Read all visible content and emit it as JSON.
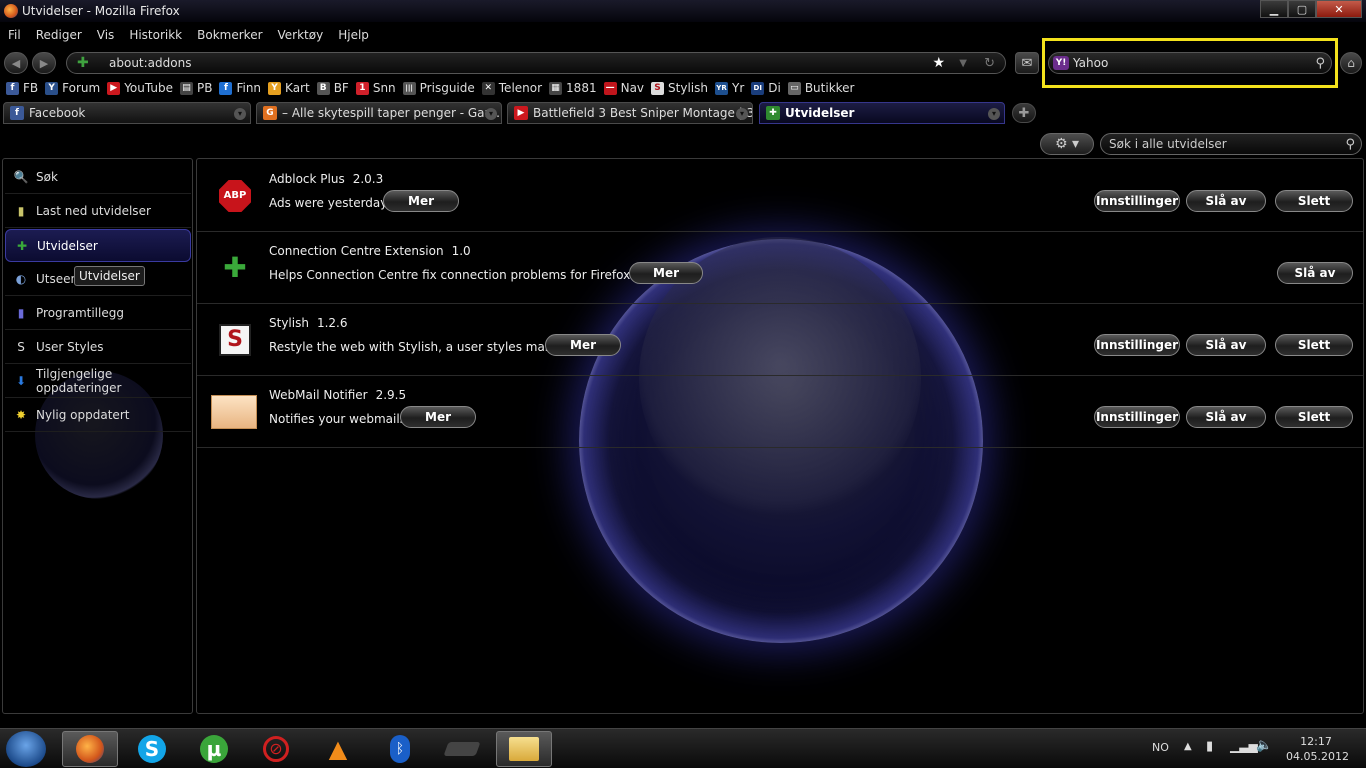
{
  "window": {
    "title": "Utvidelser - Mozilla Firefox",
    "controls": [
      "minimize",
      "maximize",
      "close"
    ]
  },
  "menu": [
    "Fil",
    "Rediger",
    "Vis",
    "Historikk",
    "Bokmerker",
    "Verktøy",
    "Hjelp"
  ],
  "navbar": {
    "url": "about:addons",
    "search_engine": "Yahoo"
  },
  "bookmarks": [
    {
      "label": "FB",
      "icon": "facebook-icon",
      "color": "#3b5998",
      "glyph": "f"
    },
    {
      "label": "Forum",
      "icon": "forum-icon",
      "color": "#2a4f8a",
      "glyph": "Y"
    },
    {
      "label": "YouTube",
      "icon": "youtube-icon",
      "color": "#cc181e",
      "glyph": "▶"
    },
    {
      "label": "PB",
      "icon": "pb-icon",
      "color": "#444444",
      "glyph": "▤"
    },
    {
      "label": "Finn",
      "icon": "finn-icon",
      "color": "#1f6fd1",
      "glyph": "f"
    },
    {
      "label": "Kart",
      "icon": "kart-icon",
      "color": "#e6a020",
      "glyph": "Y"
    },
    {
      "label": "BF",
      "icon": "bf-icon",
      "color": "#555555",
      "glyph": "B"
    },
    {
      "label": "Snn",
      "icon": "snn-icon",
      "color": "#d0202a",
      "glyph": "1"
    },
    {
      "label": "Prisguide",
      "icon": "prisguide-icon",
      "color": "#555555",
      "glyph": "|||"
    },
    {
      "label": "Telenor",
      "icon": "telenor-icon",
      "color": "#333333",
      "glyph": "✕"
    },
    {
      "label": "1881",
      "icon": "1881-icon",
      "color": "#444444",
      "glyph": "▦"
    },
    {
      "label": "Nav",
      "icon": "nav-icon",
      "color": "#c0151c",
      "glyph": "—"
    },
    {
      "label": "Stylish",
      "icon": "stylish-icon",
      "color": "#dddddd",
      "glyph": "S"
    },
    {
      "label": "Yr",
      "icon": "yr-icon",
      "color": "#1d4f8f",
      "glyph": "YR"
    },
    {
      "label": "Di",
      "icon": "di-icon",
      "color": "#1a3d7c",
      "glyph": "DI"
    },
    {
      "label": "Butikker",
      "icon": "folder-icon",
      "color": "#666666",
      "glyph": "▭"
    }
  ],
  "tabs": [
    {
      "label": "Facebook",
      "icon": "facebook-icon",
      "color": "#3b5998",
      "glyph": "f"
    },
    {
      "label": "– Alle skytespill taper penger - Gam...",
      "icon": "gamer-icon",
      "color": "#e07020",
      "glyph": "G"
    },
    {
      "label": "Battlefield 3 Best Sniper Montage | 3...",
      "icon": "youtube-icon",
      "color": "#cc181e",
      "glyph": "▶"
    },
    {
      "label": "Utvidelser",
      "icon": "puzzle-icon",
      "color": "#2f8a2f",
      "glyph": "✚",
      "active": true
    }
  ],
  "addons_toolbar": {
    "search_placeholder": "Søk i alle utvidelser"
  },
  "sidebar": {
    "items": [
      {
        "label": "Søk",
        "icon": "search-icon",
        "glyph": "🔍"
      },
      {
        "label": "Last ned utvidelser",
        "icon": "download-addons-icon",
        "glyph": "▮"
      },
      {
        "label": "Utvidelser",
        "icon": "extensions-icon",
        "glyph": "✚",
        "active": true
      },
      {
        "label": "Utseende",
        "icon": "appearance-icon",
        "glyph": "◐"
      },
      {
        "label": "Programtillegg",
        "icon": "plugins-icon",
        "glyph": "▮"
      },
      {
        "label": "User Styles",
        "icon": "user-styles-icon",
        "glyph": "S"
      },
      {
        "label": "Tilgjengelige oppdateringer",
        "icon": "updates-icon",
        "glyph": "⬇"
      },
      {
        "label": "Nylig oppdatert",
        "icon": "recent-updates-icon",
        "glyph": "✸"
      }
    ],
    "tooltip": "Utvidelser"
  },
  "addons": [
    {
      "name": "Adblock Plus",
      "version": "2.0.3",
      "description": "Ads were yesterday!",
      "more": "Mer",
      "settings": "Innstillinger",
      "disable": "Slå av",
      "remove": "Slett",
      "icon": "adblock-plus-icon"
    },
    {
      "name": "Connection Centre Extension",
      "version": "1.0",
      "description": "Helps Connection Centre fix connection problems for Firefox users",
      "more": "Mer",
      "disable": "Slå av",
      "icon": "puzzle-icon"
    },
    {
      "name": "Stylish",
      "version": "1.2.6",
      "description": "Restyle the web with Stylish, a user styles manager.",
      "more": "Mer",
      "settings": "Innstillinger",
      "disable": "Slå av",
      "remove": "Slett",
      "icon": "stylish-icon"
    },
    {
      "name": "WebMail Notifier",
      "version": "2.9.5",
      "description": "Notifies your webmails",
      "more": "Mer",
      "settings": "Innstillinger",
      "disable": "Slå av",
      "remove": "Slett",
      "icon": "mail-envelope-icon"
    }
  ],
  "taskbar": {
    "apps": [
      "firefox-icon",
      "skype-icon",
      "utorrent-icon",
      "blocked-icon",
      "vlc-icon",
      "bluetooth-icon",
      "ps3-icon",
      "explorer-icon"
    ],
    "language": "NO",
    "time": "12:17",
    "date": "04.05.2012"
  }
}
